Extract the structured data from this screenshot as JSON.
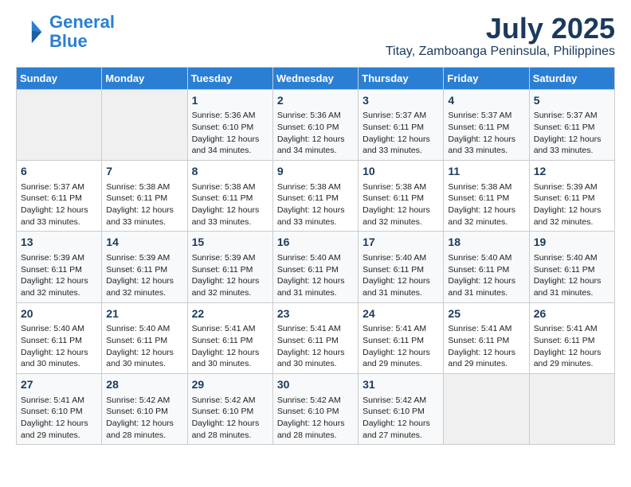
{
  "logo": {
    "line1": "General",
    "line2": "Blue"
  },
  "title": "July 2025",
  "subtitle": "Titay, Zamboanga Peninsula, Philippines",
  "days_of_week": [
    "Sunday",
    "Monday",
    "Tuesday",
    "Wednesday",
    "Thursday",
    "Friday",
    "Saturday"
  ],
  "weeks": [
    [
      {
        "day": "",
        "content": ""
      },
      {
        "day": "",
        "content": ""
      },
      {
        "day": "1",
        "content": "Sunrise: 5:36 AM\nSunset: 6:10 PM\nDaylight: 12 hours\nand 34 minutes."
      },
      {
        "day": "2",
        "content": "Sunrise: 5:36 AM\nSunset: 6:10 PM\nDaylight: 12 hours\nand 34 minutes."
      },
      {
        "day": "3",
        "content": "Sunrise: 5:37 AM\nSunset: 6:11 PM\nDaylight: 12 hours\nand 33 minutes."
      },
      {
        "day": "4",
        "content": "Sunrise: 5:37 AM\nSunset: 6:11 PM\nDaylight: 12 hours\nand 33 minutes."
      },
      {
        "day": "5",
        "content": "Sunrise: 5:37 AM\nSunset: 6:11 PM\nDaylight: 12 hours\nand 33 minutes."
      }
    ],
    [
      {
        "day": "6",
        "content": "Sunrise: 5:37 AM\nSunset: 6:11 PM\nDaylight: 12 hours\nand 33 minutes."
      },
      {
        "day": "7",
        "content": "Sunrise: 5:38 AM\nSunset: 6:11 PM\nDaylight: 12 hours\nand 33 minutes."
      },
      {
        "day": "8",
        "content": "Sunrise: 5:38 AM\nSunset: 6:11 PM\nDaylight: 12 hours\nand 33 minutes."
      },
      {
        "day": "9",
        "content": "Sunrise: 5:38 AM\nSunset: 6:11 PM\nDaylight: 12 hours\nand 33 minutes."
      },
      {
        "day": "10",
        "content": "Sunrise: 5:38 AM\nSunset: 6:11 PM\nDaylight: 12 hours\nand 32 minutes."
      },
      {
        "day": "11",
        "content": "Sunrise: 5:38 AM\nSunset: 6:11 PM\nDaylight: 12 hours\nand 32 minutes."
      },
      {
        "day": "12",
        "content": "Sunrise: 5:39 AM\nSunset: 6:11 PM\nDaylight: 12 hours\nand 32 minutes."
      }
    ],
    [
      {
        "day": "13",
        "content": "Sunrise: 5:39 AM\nSunset: 6:11 PM\nDaylight: 12 hours\nand 32 minutes."
      },
      {
        "day": "14",
        "content": "Sunrise: 5:39 AM\nSunset: 6:11 PM\nDaylight: 12 hours\nand 32 minutes."
      },
      {
        "day": "15",
        "content": "Sunrise: 5:39 AM\nSunset: 6:11 PM\nDaylight: 12 hours\nand 32 minutes."
      },
      {
        "day": "16",
        "content": "Sunrise: 5:40 AM\nSunset: 6:11 PM\nDaylight: 12 hours\nand 31 minutes."
      },
      {
        "day": "17",
        "content": "Sunrise: 5:40 AM\nSunset: 6:11 PM\nDaylight: 12 hours\nand 31 minutes."
      },
      {
        "day": "18",
        "content": "Sunrise: 5:40 AM\nSunset: 6:11 PM\nDaylight: 12 hours\nand 31 minutes."
      },
      {
        "day": "19",
        "content": "Sunrise: 5:40 AM\nSunset: 6:11 PM\nDaylight: 12 hours\nand 31 minutes."
      }
    ],
    [
      {
        "day": "20",
        "content": "Sunrise: 5:40 AM\nSunset: 6:11 PM\nDaylight: 12 hours\nand 30 minutes."
      },
      {
        "day": "21",
        "content": "Sunrise: 5:40 AM\nSunset: 6:11 PM\nDaylight: 12 hours\nand 30 minutes."
      },
      {
        "day": "22",
        "content": "Sunrise: 5:41 AM\nSunset: 6:11 PM\nDaylight: 12 hours\nand 30 minutes."
      },
      {
        "day": "23",
        "content": "Sunrise: 5:41 AM\nSunset: 6:11 PM\nDaylight: 12 hours\nand 30 minutes."
      },
      {
        "day": "24",
        "content": "Sunrise: 5:41 AM\nSunset: 6:11 PM\nDaylight: 12 hours\nand 29 minutes."
      },
      {
        "day": "25",
        "content": "Sunrise: 5:41 AM\nSunset: 6:11 PM\nDaylight: 12 hours\nand 29 minutes."
      },
      {
        "day": "26",
        "content": "Sunrise: 5:41 AM\nSunset: 6:11 PM\nDaylight: 12 hours\nand 29 minutes."
      }
    ],
    [
      {
        "day": "27",
        "content": "Sunrise: 5:41 AM\nSunset: 6:10 PM\nDaylight: 12 hours\nand 29 minutes."
      },
      {
        "day": "28",
        "content": "Sunrise: 5:42 AM\nSunset: 6:10 PM\nDaylight: 12 hours\nand 28 minutes."
      },
      {
        "day": "29",
        "content": "Sunrise: 5:42 AM\nSunset: 6:10 PM\nDaylight: 12 hours\nand 28 minutes."
      },
      {
        "day": "30",
        "content": "Sunrise: 5:42 AM\nSunset: 6:10 PM\nDaylight: 12 hours\nand 28 minutes."
      },
      {
        "day": "31",
        "content": "Sunrise: 5:42 AM\nSunset: 6:10 PM\nDaylight: 12 hours\nand 27 minutes."
      },
      {
        "day": "",
        "content": ""
      },
      {
        "day": "",
        "content": ""
      }
    ]
  ]
}
